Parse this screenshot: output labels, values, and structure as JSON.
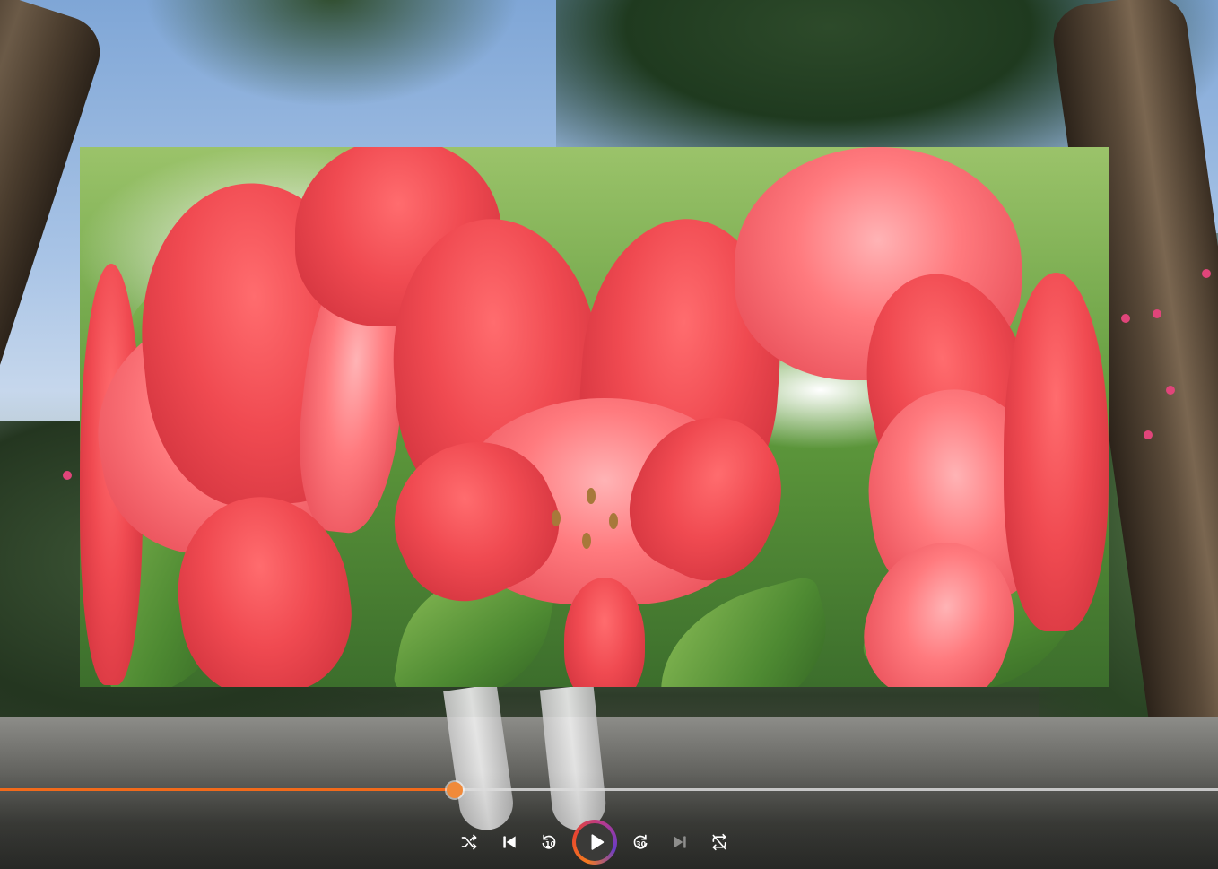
{
  "player": {
    "progress_fraction": 0.373,
    "accent_color": "#f26a1b",
    "controls": {
      "shuffle": {
        "icon": "shuffle-icon"
      },
      "previous": {
        "icon": "skip-previous-icon"
      },
      "rewind": {
        "icon": "rewind-icon",
        "seconds": "10"
      },
      "play": {
        "icon": "play-icon"
      },
      "forward": {
        "icon": "fast-forward-icon",
        "seconds": "30"
      },
      "next": {
        "icon": "skip-next-icon",
        "disabled": true
      },
      "repeat": {
        "icon": "repeat-off-icon"
      }
    }
  }
}
